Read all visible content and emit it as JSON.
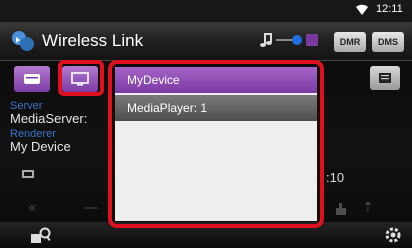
{
  "status_bar": {
    "time": "12:11"
  },
  "header": {
    "title": "Wireless Link",
    "dmr_label": "DMR",
    "dms_label": "DMS"
  },
  "info": {
    "server_label": "Server",
    "server_value": "MediaServer:",
    "renderer_label": "Renderer",
    "renderer_value": "My Device"
  },
  "playback": {
    "time_fragment": ":10"
  },
  "device_list": {
    "items": [
      {
        "label": "MyDevice",
        "selected": true
      },
      {
        "label": "MediaPlayer: 1",
        "selected": false
      }
    ]
  },
  "colors": {
    "accent_purple": "#8a48b2",
    "highlight_red": "#e0101e",
    "label_blue": "#3a72c8"
  }
}
